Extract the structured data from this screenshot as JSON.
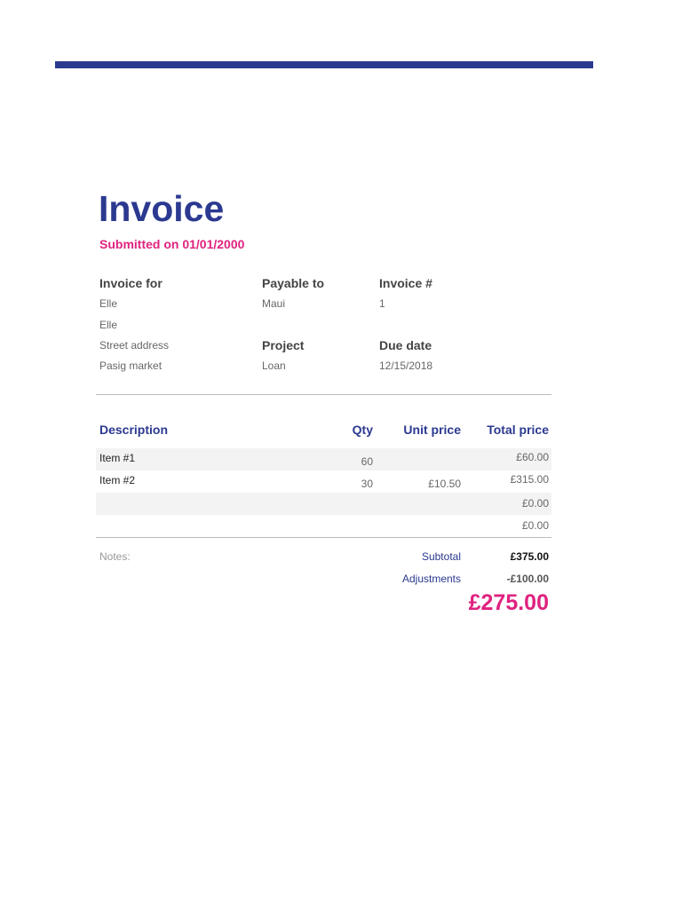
{
  "title": "Invoice",
  "submitted": "Submitted on 01/01/2000",
  "invoice_for": {
    "label": "Invoice for",
    "lines": [
      "Elle",
      "Elle",
      "Street address",
      "Pasig market"
    ]
  },
  "payable_to": {
    "label": "Payable to",
    "value": "Maui"
  },
  "invoice_num": {
    "label": "Invoice #",
    "value": "1"
  },
  "project": {
    "label": "Project",
    "value": "Loan"
  },
  "due_date": {
    "label": "Due date",
    "value": "12/15/2018"
  },
  "table": {
    "headers": [
      "Description",
      "Qty",
      "Unit price",
      "Total price"
    ],
    "rows": [
      {
        "desc": "Item #1",
        "qty": "60",
        "unit": "",
        "total": "£60.00"
      },
      {
        "desc": "Item #2",
        "qty": "30",
        "unit": "£10.50",
        "total": "£315.00"
      },
      {
        "desc": "",
        "qty": "",
        "unit": "",
        "total": "£0.00"
      },
      {
        "desc": "",
        "qty": "",
        "unit": "",
        "total": "£0.00"
      }
    ]
  },
  "notes_label": "Notes:",
  "subtotal": {
    "label": "Subtotal",
    "value": "£375.00"
  },
  "adjustments": {
    "label": "Adjustments",
    "value": "-£100.00"
  },
  "grand_total": "£275.00",
  "colors": {
    "accent": "#2b3990",
    "highlight": "#e0227f"
  }
}
